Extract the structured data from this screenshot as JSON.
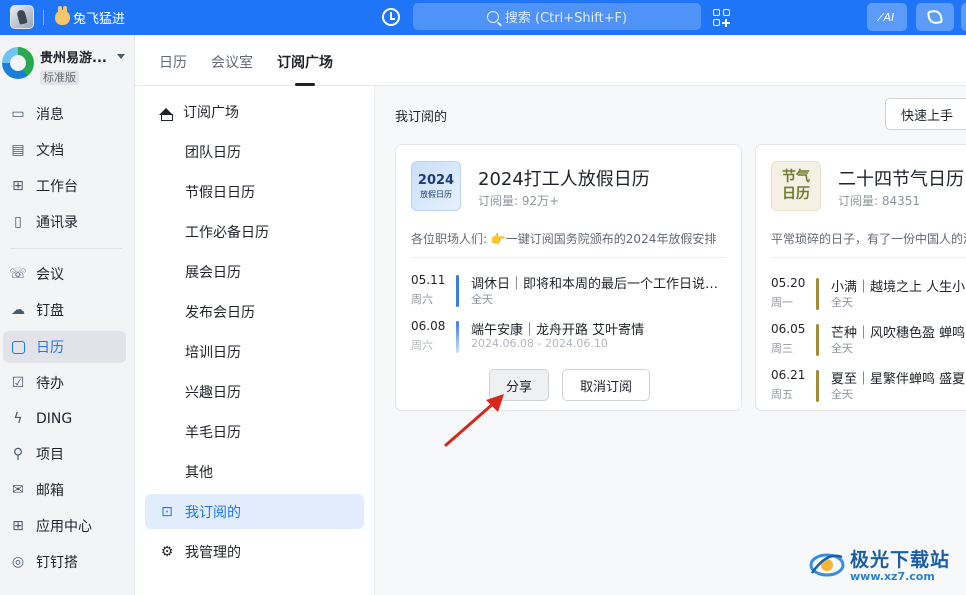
{
  "topbar": {
    "user_tag": "兔飞猛进",
    "search_placeholder": "搜索 (Ctrl+Shift+F)",
    "ai_label": "AI"
  },
  "org": {
    "name": "贵州易游...",
    "badge": "标准版"
  },
  "leftnav": {
    "items": [
      {
        "label": "消息",
        "icon": "message-icon"
      },
      {
        "label": "文档",
        "icon": "document-icon"
      },
      {
        "label": "工作台",
        "icon": "workbench-icon"
      },
      {
        "label": "通讯录",
        "icon": "contacts-icon"
      },
      {
        "label": "会议",
        "icon": "meeting-icon"
      },
      {
        "label": "钉盘",
        "icon": "cloud-drive-icon"
      },
      {
        "label": "日历",
        "icon": "calendar-icon"
      },
      {
        "label": "待办",
        "icon": "todo-icon"
      },
      {
        "label": "DING",
        "icon": "ding-icon"
      },
      {
        "label": "项目",
        "icon": "project-icon"
      },
      {
        "label": "邮箱",
        "icon": "mail-icon"
      },
      {
        "label": "应用中心",
        "icon": "app-center-icon"
      },
      {
        "label": "钉钉搭",
        "icon": "builder-icon"
      }
    ],
    "active": "日历"
  },
  "tabs": [
    "日历",
    "会议室",
    "订阅广场"
  ],
  "active_tab": "订阅广场",
  "submenu": {
    "header": "订阅广场",
    "children": [
      "团队日历",
      "节假日日历",
      "工作必备日历",
      "展会日历",
      "发布会日历",
      "培训日历",
      "兴趣日历",
      "羊毛日历",
      "其他"
    ],
    "subscribed": "我订阅的",
    "managed": "我管理的"
  },
  "main": {
    "section_title": "我订阅的",
    "quick_start": "快速上手",
    "cards": [
      {
        "cover_big": "2024",
        "cover_small": "放假日历",
        "title": "2024打工人放假日历",
        "subscribers": "订阅量: 92万+",
        "desc": "各位职场人们: 👉一键订阅国务院颁布的2024年放假安排",
        "events": [
          {
            "date": "05.11",
            "week": "周六",
            "title": "调休日｜即将和本周的最后一个工作日说再见",
            "time": "全天"
          },
          {
            "date": "06.08",
            "week": "周六",
            "title": "端午安康｜龙舟开路 艾叶寄情",
            "time": "2024.06.08 - 2024.06.10"
          }
        ],
        "share_label": "分享",
        "unsubscribe_label": "取消订阅",
        "accent": "#3b7be6"
      },
      {
        "cover_lines": [
          "节气",
          "日历"
        ],
        "title": "二十四节气日历",
        "subscribers": "订阅量: 84351",
        "desc": "平常琐碎的日子，有了一份中国人的浪漫",
        "events": [
          {
            "date": "05.20",
            "week": "周一",
            "title": "小满｜越境之上 人生小满",
            "time": "全天"
          },
          {
            "date": "06.05",
            "week": "周三",
            "title": "芒种｜风吹穗色盈 蝉鸣",
            "time": "全天"
          },
          {
            "date": "06.21",
            "week": "周五",
            "title": "夏至｜星繁伴蝉鸣 盛夏",
            "time": "全天"
          }
        ],
        "accent": "#a38a3a"
      }
    ]
  },
  "watermark": {
    "cn": "极光下载站",
    "url": "www.xz7.com"
  },
  "colors": {
    "brand": "#1f75f6",
    "active_bg": "#e1ecfd",
    "annotation_arrow": "#d9261c"
  }
}
